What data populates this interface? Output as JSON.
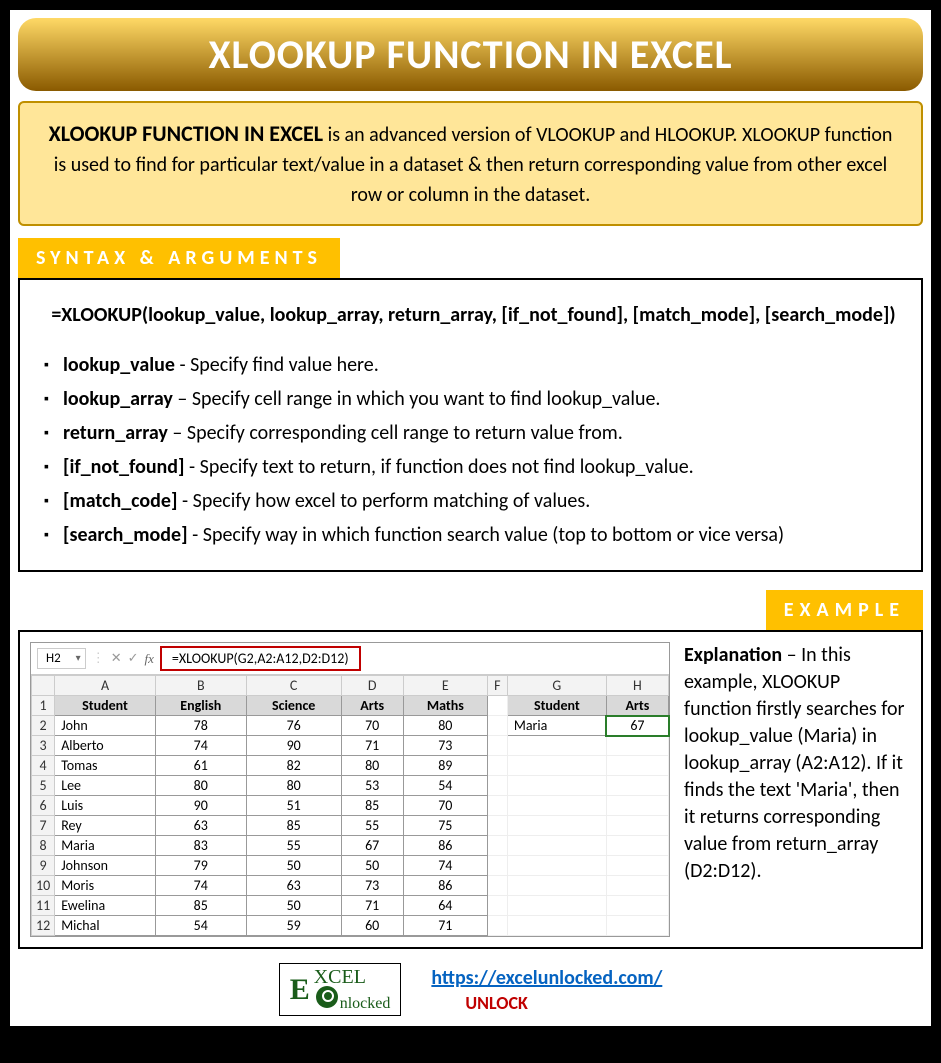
{
  "title": "XLOOKUP FUNCTION IN EXCEL",
  "intro": {
    "lead": "XLOOKUP FUNCTION IN EXCEL",
    "rest": " is an advanced version of VLOOKUP and HLOOKUP. XLOOKUP function is used to find for particular text/value in a dataset & then return corresponding value from other excel row or column in the dataset."
  },
  "section_syntax_label": "SYNTAX & ARGUMENTS",
  "syntax_formula": "=XLOOKUP(lookup_value, lookup_array, return_array, [if_not_found], [match_mode], [search_mode])",
  "arguments": [
    {
      "name": "lookup_value",
      "desc": " - Specify find value here."
    },
    {
      "name": "lookup_array",
      "desc": " – Specify cell range in which you want to find lookup_value."
    },
    {
      "name": "return_array",
      "desc": " – Specify corresponding cell range to return value from."
    },
    {
      "name": "[if_not_found]",
      "desc": " - Specify text to return, if function does not find lookup_value."
    },
    {
      "name": "[match_code]",
      "desc": " - Specify how excel to perform matching of values."
    },
    {
      "name": "[search_mode]",
      "desc": " - Specify way in which function search value (top to bottom or vice versa)"
    }
  ],
  "section_example_label": "EXAMPLE",
  "excel": {
    "namebox": "H2",
    "formula": "=XLOOKUP(G2,A2:A12,D2:D12)",
    "cols": [
      "A",
      "B",
      "C",
      "D",
      "E",
      "F",
      "G",
      "H"
    ],
    "headers": [
      "Student",
      "English",
      "Science",
      "Arts",
      "Maths"
    ],
    "side_headers": [
      "Student",
      "Arts"
    ],
    "side_row": {
      "student": "Maria",
      "arts": "67"
    },
    "rows": [
      {
        "n": "1"
      },
      {
        "n": "2",
        "a": "John",
        "b": "78",
        "c": "76",
        "d": "70",
        "e": "80"
      },
      {
        "n": "3",
        "a": "Alberto",
        "b": "74",
        "c": "90",
        "d": "71",
        "e": "73"
      },
      {
        "n": "4",
        "a": "Tomas",
        "b": "61",
        "c": "82",
        "d": "80",
        "e": "89"
      },
      {
        "n": "5",
        "a": "Lee",
        "b": "80",
        "c": "80",
        "d": "53",
        "e": "54"
      },
      {
        "n": "6",
        "a": "Luis",
        "b": "90",
        "c": "51",
        "d": "85",
        "e": "70"
      },
      {
        "n": "7",
        "a": "Rey",
        "b": "63",
        "c": "85",
        "d": "55",
        "e": "75"
      },
      {
        "n": "8",
        "a": "Maria",
        "b": "83",
        "c": "55",
        "d": "67",
        "e": "86"
      },
      {
        "n": "9",
        "a": "Johnson",
        "b": "79",
        "c": "50",
        "d": "50",
        "e": "74"
      },
      {
        "n": "10",
        "a": "Moris",
        "b": "74",
        "c": "63",
        "d": "73",
        "e": "86"
      },
      {
        "n": "11",
        "a": "Ewelina",
        "b": "85",
        "c": "50",
        "d": "71",
        "e": "64"
      },
      {
        "n": "12",
        "a": "Michal",
        "b": "54",
        "c": "59",
        "d": "60",
        "e": "71"
      }
    ]
  },
  "explanation": {
    "lead": "Explanation",
    "text": " – In this example, XLOOKUP function firstly searches for lookup_value (Maria) in lookup_array (A2:A12). If it finds the text 'Maria', then it returns corresponding value from return_array (D2:D12)."
  },
  "footer": {
    "logo_top": "EXCEL",
    "logo_bottom": "Unlocked",
    "url": "https://excelunlocked.com/",
    "unlock": "UNLOCK"
  }
}
